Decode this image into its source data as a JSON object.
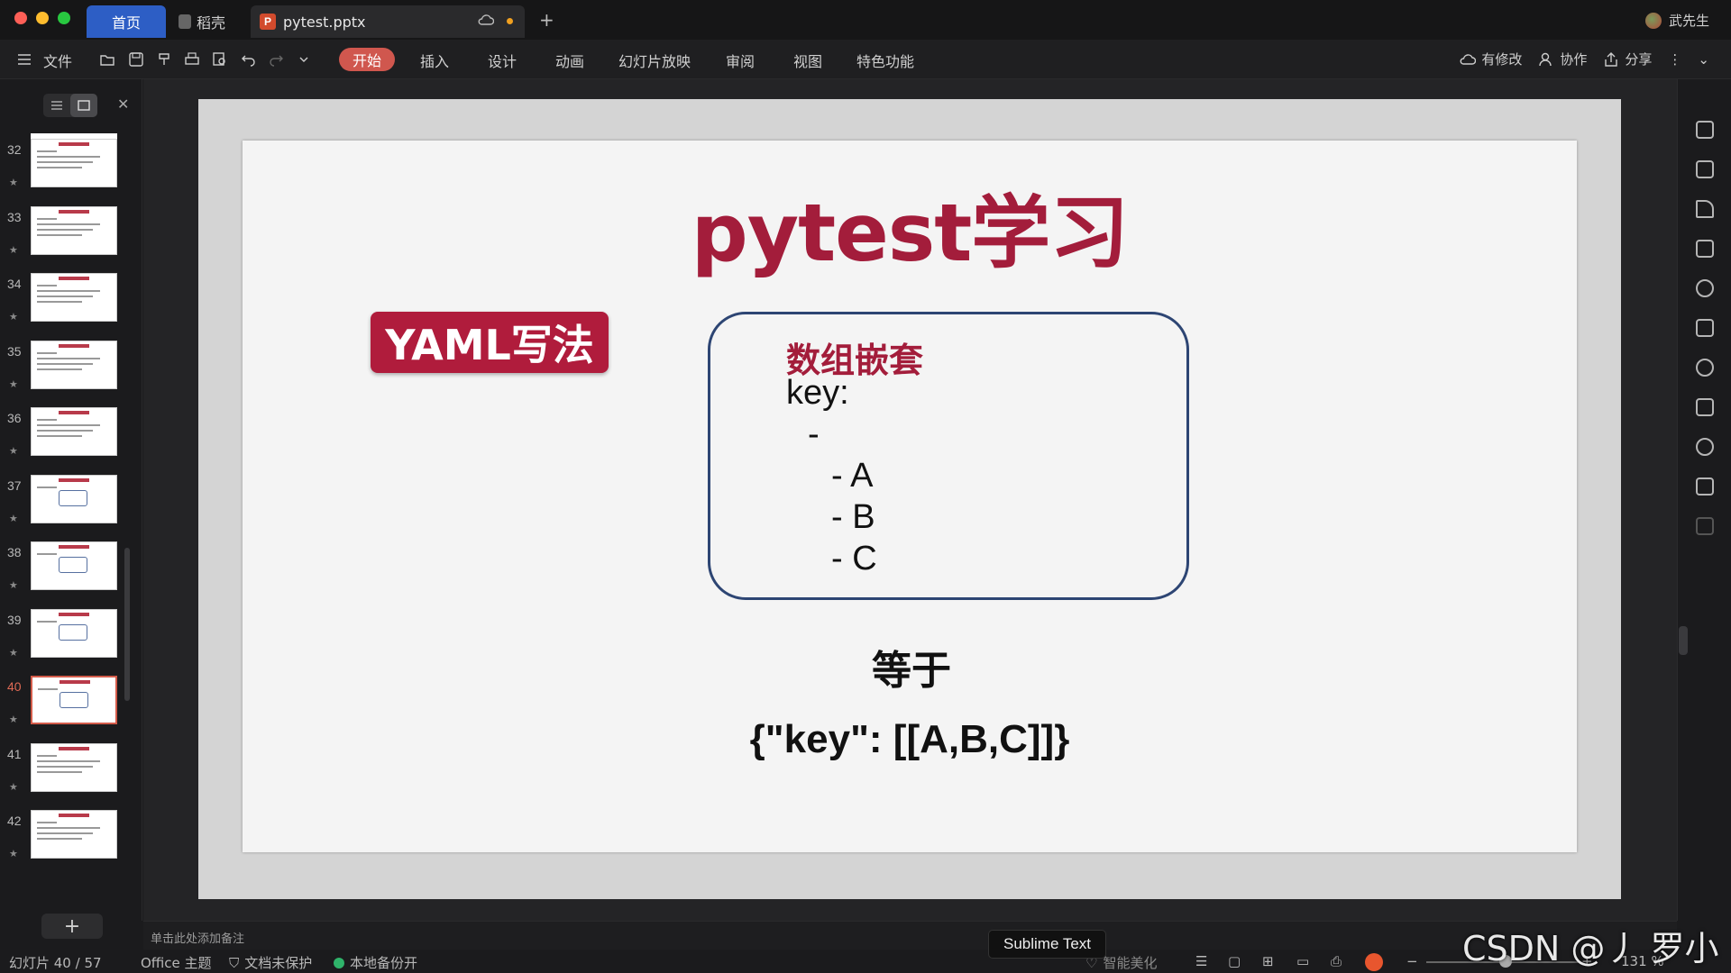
{
  "tabs": {
    "home": "首页",
    "daoke": "稻壳",
    "file": "pytest.pptx",
    "file_icon_letter": "P"
  },
  "user": {
    "name": "武先生"
  },
  "menu": {
    "file": "文件",
    "start": "开始",
    "insert": "插入",
    "design": "设计",
    "animation": "动画",
    "slideshow": "幻灯片放映",
    "review": "审阅",
    "view": "视图",
    "special": "特色功能"
  },
  "right_tools": {
    "modified": "有修改",
    "collab": "协作",
    "share": "分享"
  },
  "thumbnails": [
    {
      "num": "32"
    },
    {
      "num": "33"
    },
    {
      "num": "34"
    },
    {
      "num": "35"
    },
    {
      "num": "36"
    },
    {
      "num": "37"
    },
    {
      "num": "38"
    },
    {
      "num": "39"
    },
    {
      "num": "40"
    },
    {
      "num": "41"
    },
    {
      "num": "42"
    }
  ],
  "active_slide": "40",
  "slide": {
    "title": "pytest学习",
    "badge": "YAML写法",
    "box_heading": "数组嵌套",
    "lines": [
      "key:",
      "-",
      "- A",
      "- B",
      "- C"
    ],
    "equals": "等于",
    "json": "{\"key\": [[A,B,C]]}"
  },
  "notes_placeholder": "单击此处添加备注",
  "status": {
    "slide_count": "幻灯片 40 / 57",
    "theme": "Office 主题",
    "protect": "文档未保护",
    "backup": "本地备份开",
    "beautify": "智能美化",
    "zoom": "131 %"
  },
  "tooltip": "Sublime Text",
  "watermark": "CSDN @丿 罗小黑",
  "colors": {
    "accent_tab": "#2d5ec5",
    "start_pill": "#d0574e",
    "title_red": "#a31d3b",
    "box_border": "#2d4573"
  }
}
